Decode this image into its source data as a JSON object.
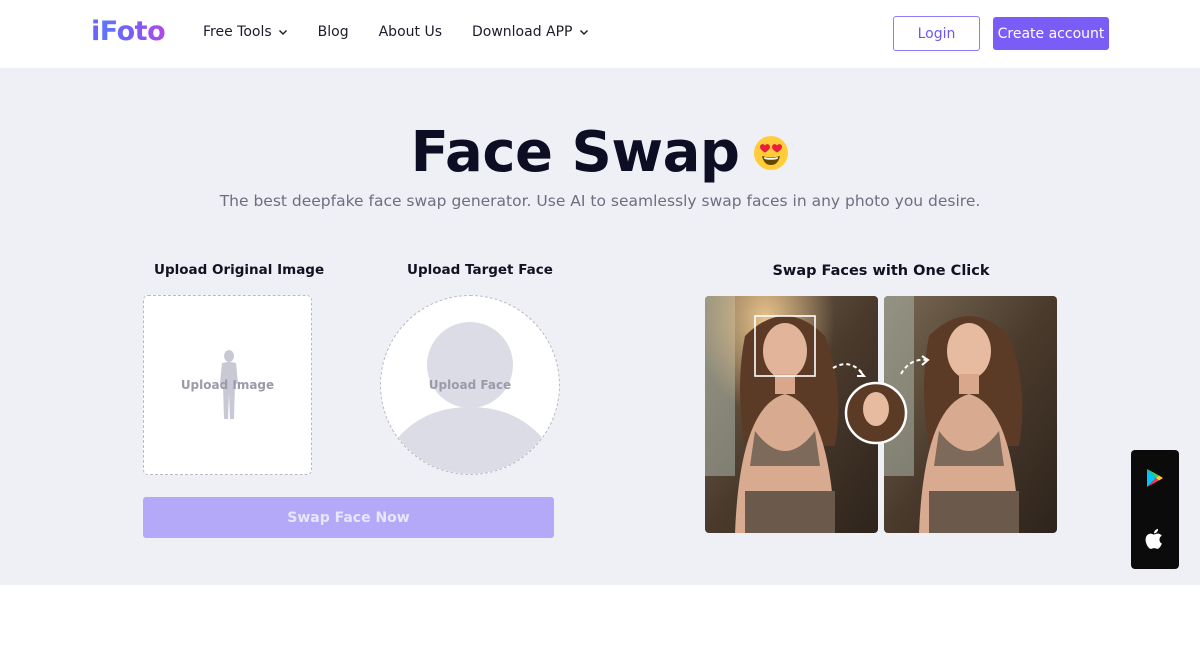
{
  "nav": {
    "logo_i": "i",
    "logo_rest": "Foto",
    "links": [
      {
        "label": "Free Tools",
        "has_dropdown": true
      },
      {
        "label": "Blog",
        "has_dropdown": false
      },
      {
        "label": "About Us",
        "has_dropdown": false
      },
      {
        "label": "Download APP",
        "has_dropdown": true
      }
    ],
    "login_label": "Login",
    "create_label": "Create account"
  },
  "hero": {
    "title": "Face Swap",
    "emoji_icon": "heart-eyes-emoji-icon",
    "subtitle": "The best deepfake face swap generator. Use AI to seamlessly swap faces in any photo you desire."
  },
  "upload": {
    "original_label": "Upload Original Image",
    "original_placeholder": "Upload Image",
    "target_label": "Upload Target Face",
    "target_placeholder": "Upload Face",
    "swap_button": "Swap Face Now"
  },
  "demo": {
    "title": "Swap Faces with One Click"
  },
  "app_bar": {
    "icons": [
      "google-play-icon",
      "apple-icon"
    ]
  },
  "colors": {
    "accent": "#7a5cf6",
    "hero_bg": "#efeff6",
    "swap_button_bg": "#b4a9f8",
    "title": "#0d0d24"
  }
}
